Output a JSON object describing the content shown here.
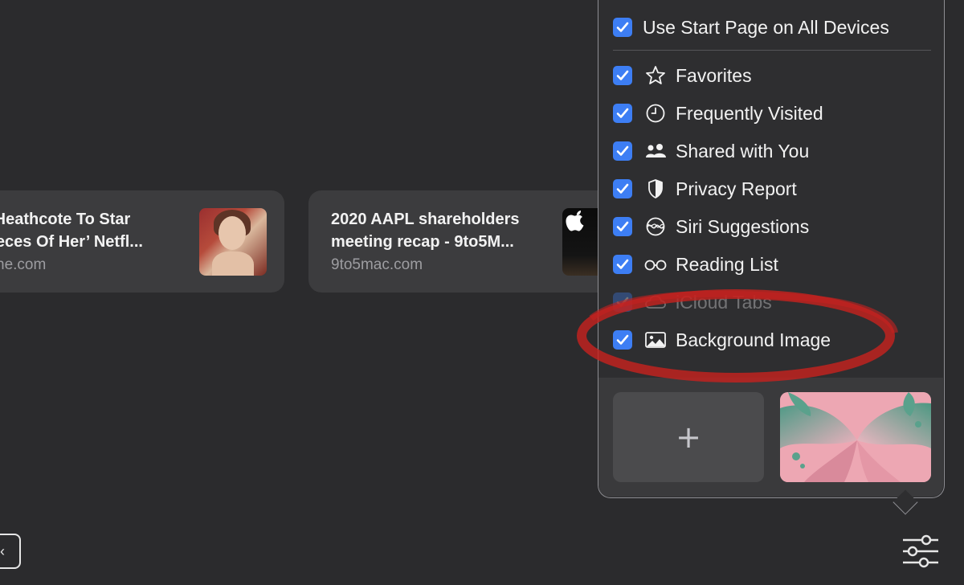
{
  "cards": [
    {
      "title_line1": "a Heathcote To Star",
      "title_line2": "Pieces Of Her’ Netfl...",
      "domain": "dline.com",
      "thumb_icon": "portrait-thumbnail"
    },
    {
      "title_line1": "2020 AAPL shareholders",
      "title_line2": "meeting recap - 9to5M...",
      "domain": "9to5mac.com",
      "thumb_icon": "apple-logo-thumbnail",
      "thumb_glyph": ""
    }
  ],
  "popover": {
    "top_option": {
      "label": "Use Start Page on All Devices",
      "checked": true
    },
    "options": [
      {
        "label": "Favorites",
        "icon": "star-icon",
        "checked": true,
        "enabled": true
      },
      {
        "label": "Frequently Visited",
        "icon": "clock-icon",
        "checked": true,
        "enabled": true
      },
      {
        "label": "Shared with You",
        "icon": "people-icon",
        "checked": true,
        "enabled": true
      },
      {
        "label": "Privacy Report",
        "icon": "shield-icon",
        "checked": true,
        "enabled": true
      },
      {
        "label": "Siri Suggestions",
        "icon": "siri-icon",
        "checked": true,
        "enabled": true
      },
      {
        "label": "Reading List",
        "icon": "glasses-icon",
        "checked": true,
        "enabled": true
      },
      {
        "label": "iCloud Tabs",
        "icon": "cloud-icon",
        "checked": true,
        "enabled": false
      },
      {
        "label": "Background Image",
        "icon": "photo-icon",
        "checked": true,
        "enabled": true
      }
    ],
    "add_tile_glyph": "+"
  },
  "bottom_left_glyph": "‹",
  "colors": {
    "background": "#2b2b2d",
    "checkbox": "#3d7ef4",
    "annotation": "#c4221f"
  }
}
